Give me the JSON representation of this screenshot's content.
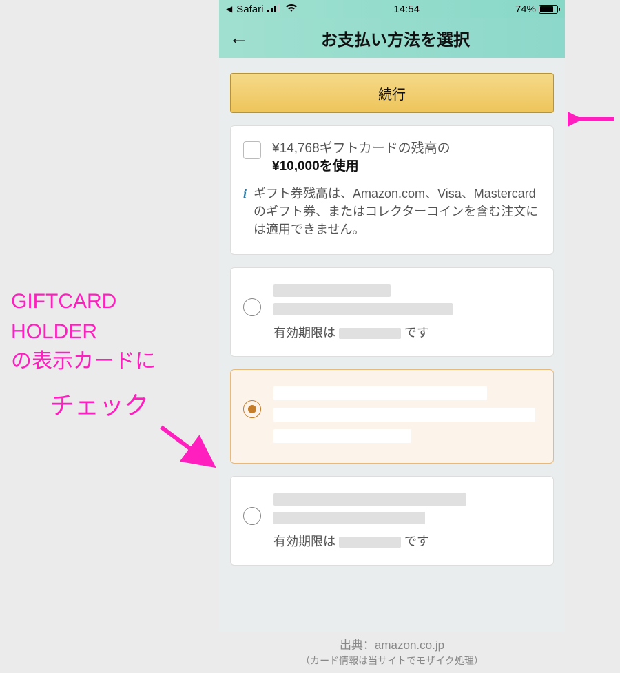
{
  "statusbar": {
    "back_app": "Safari",
    "time": "14:54",
    "battery_pct": "74%"
  },
  "appbar": {
    "title": "お支払い方法を選択"
  },
  "continue_label": "続行",
  "giftcard": {
    "line1": "¥14,768ギフトカードの残高の",
    "line2": "¥10,000を使用",
    "info": "ギフト券残高は、Amazon.com、Visa、Mastercardのギフト券、またはコレクターコインを含む注文には適用できません。"
  },
  "options": [
    {
      "selected": false,
      "expiry_prefix": "有効期限は",
      "expiry_suffix": "です"
    },
    {
      "selected": true
    },
    {
      "selected": false,
      "expiry_prefix": "有効期限は",
      "expiry_suffix": "です"
    }
  ],
  "annotation": {
    "line1": "GIFTCARD",
    "line2": "HOLDER",
    "line3": "の表示カードに",
    "check": "チェック"
  },
  "credit": {
    "source": "出典：amazon.co.jp",
    "note": "（カード情報は当サイトでモザイク処理）"
  }
}
